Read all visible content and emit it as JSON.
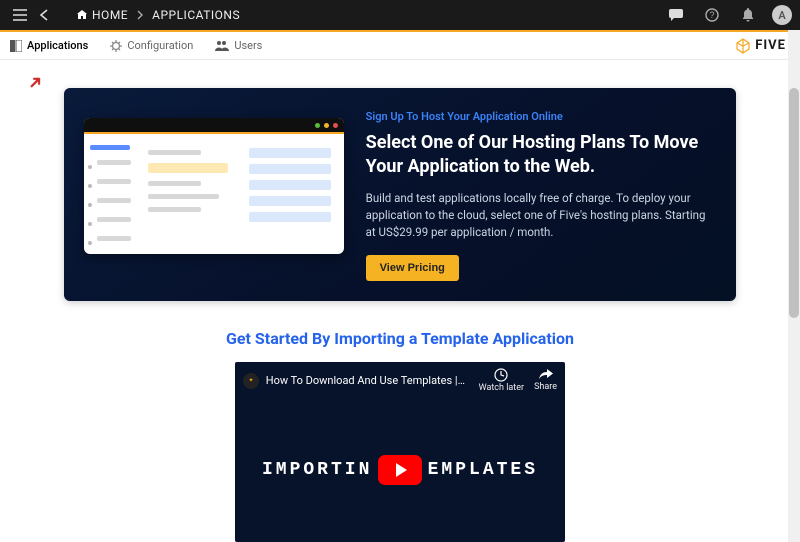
{
  "topbar": {
    "home_label": "HOME",
    "crumb_current": "APPLICATIONS",
    "avatar_initial": "A"
  },
  "tabs": {
    "applications": "Applications",
    "configuration": "Configuration",
    "users": "Users"
  },
  "brand": "FIVE",
  "hero": {
    "eyebrow": "Sign Up To Host Your Application Online",
    "title": "Select One of Our Hosting Plans To Move Your Application to the Web.",
    "body": "Build and test applications locally free of charge. To deploy your application to the cloud, select one of Five's hosting plans. Starting at US$29.99 per application / month.",
    "cta": "View Pricing"
  },
  "import": {
    "title": "Get Started By Importing a Template Application"
  },
  "video": {
    "title": "How To Download And Use Templates |…",
    "watch_later": "Watch later",
    "share": "Share",
    "overlay_a": "IMPORTIN",
    "overlay_b": "EMPLATES"
  }
}
